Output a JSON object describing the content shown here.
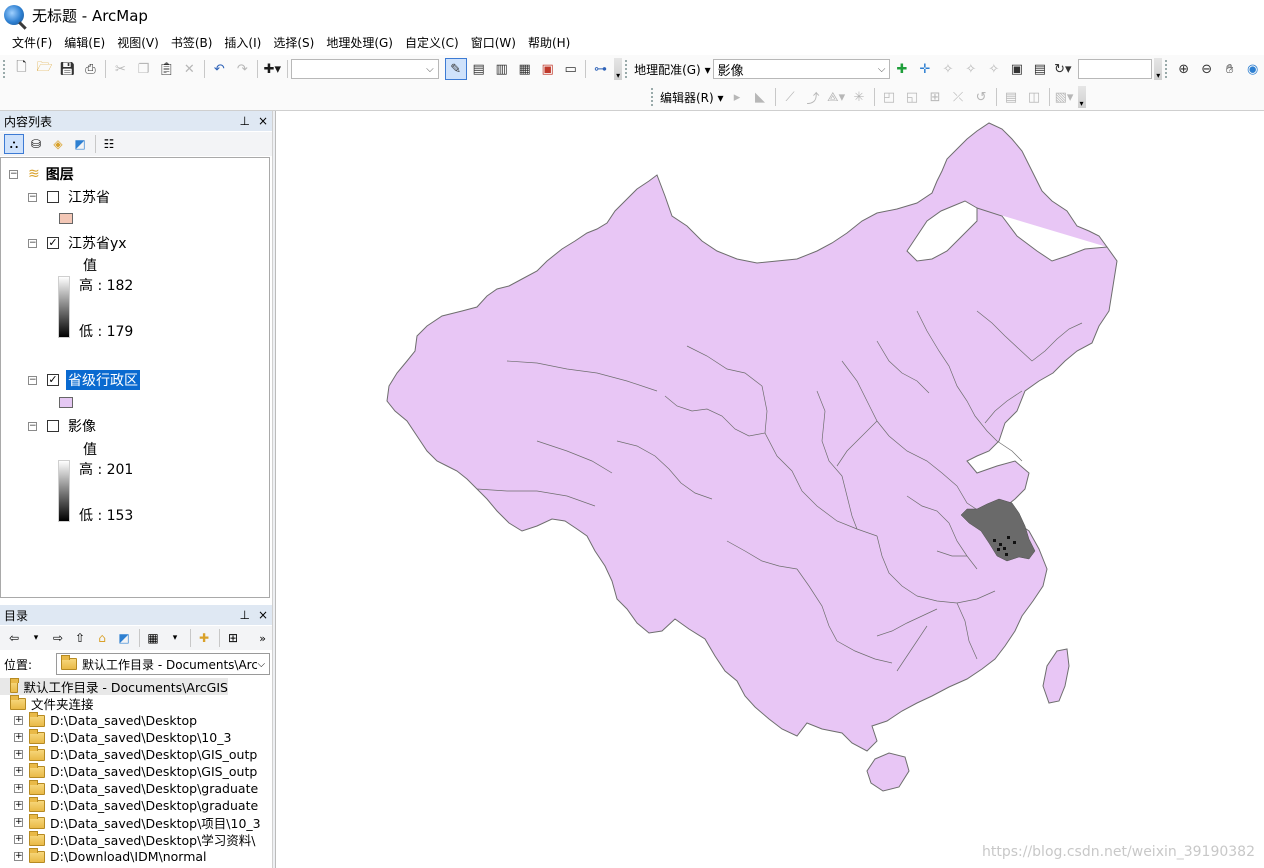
{
  "window": {
    "title": "无标题 - ArcMap"
  },
  "menu": [
    {
      "label": "文件(F)"
    },
    {
      "label": "编辑(E)"
    },
    {
      "label": "视图(V)"
    },
    {
      "label": "书签(B)"
    },
    {
      "label": "插入(I)"
    },
    {
      "label": "选择(S)"
    },
    {
      "label": "地理处理(G)"
    },
    {
      "label": "自定义(C)"
    },
    {
      "label": "窗口(W)"
    },
    {
      "label": "帮助(H)"
    }
  ],
  "toolbar": {
    "georef_label": "地理配准(G)",
    "georef_layer_value": "影像",
    "editor_label": "编辑器(R)",
    "scale_value": ""
  },
  "toc": {
    "title": "内容列表",
    "pin": "ꟷ",
    "close": "×",
    "group_label": "图层",
    "layers": [
      {
        "name": "江苏省",
        "checked": false,
        "swatch_color": "#f3c7b6"
      },
      {
        "name": "江苏省yx",
        "checked": true,
        "legend_title": "值",
        "high": "高 : 182",
        "low": "低 : 179"
      },
      {
        "name": "省级行政区",
        "checked": true,
        "selected": true,
        "swatch_color": "#e5c8f3"
      },
      {
        "name": "影像",
        "checked": false,
        "legend_title": "值",
        "high": "高 : 201",
        "low": "低 : 153"
      }
    ]
  },
  "catalog": {
    "title": "目录",
    "location_label": "位置:",
    "location_value": "默认工作目录 - Documents\\ArcGIS",
    "items": [
      {
        "label": "默认工作目录 - Documents\\ArcGIS",
        "level": 0
      },
      {
        "label": "文件夹连接",
        "level": 0
      },
      {
        "label": "D:\\Data_saved\\Desktop",
        "level": 1
      },
      {
        "label": "D:\\Data_saved\\Desktop\\10_3",
        "level": 1
      },
      {
        "label": "D:\\Data_saved\\Desktop\\GIS_outp",
        "level": 1
      },
      {
        "label": "D:\\Data_saved\\Desktop\\GIS_outp",
        "level": 1
      },
      {
        "label": "D:\\Data_saved\\Desktop\\graduate",
        "level": 1
      },
      {
        "label": "D:\\Data_saved\\Desktop\\graduate",
        "level": 1
      },
      {
        "label": "D:\\Data_saved\\Desktop\\项目\\10_3",
        "level": 1
      },
      {
        "label": "D:\\Data_saved\\Desktop\\学习资料\\",
        "level": 1
      },
      {
        "label": "D:\\Download\\IDM\\normal",
        "level": 1
      }
    ]
  },
  "map": {
    "fill_color": "#e8c6f5",
    "stroke_color": "#6e6e6e",
    "raster_color": "#6a6a6a",
    "watermark": "https://blog.csdn.net/weixin_39190382"
  }
}
